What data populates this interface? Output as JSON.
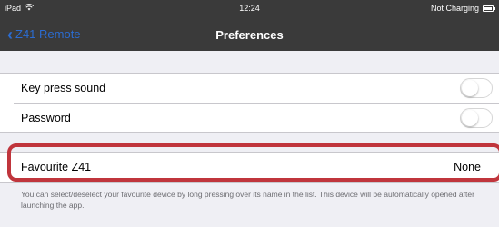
{
  "status": {
    "device": "iPad",
    "time": "12:24",
    "charging": "Not Charging"
  },
  "navbar": {
    "back_label": "Z41 Remote",
    "title": "Preferences"
  },
  "settings": {
    "key_press_sound": {
      "label": "Key press sound",
      "enabled": false
    },
    "password": {
      "label": "Password",
      "enabled": false
    }
  },
  "favourite": {
    "label": "Favourite Z41",
    "value": "None",
    "footer": "You can select/deselect your favourite device by long pressing over its name in the list. This device will be automatically opened after launching the app."
  },
  "colors": {
    "accent": "#2b6cd1",
    "highlight": "#c0353c"
  }
}
